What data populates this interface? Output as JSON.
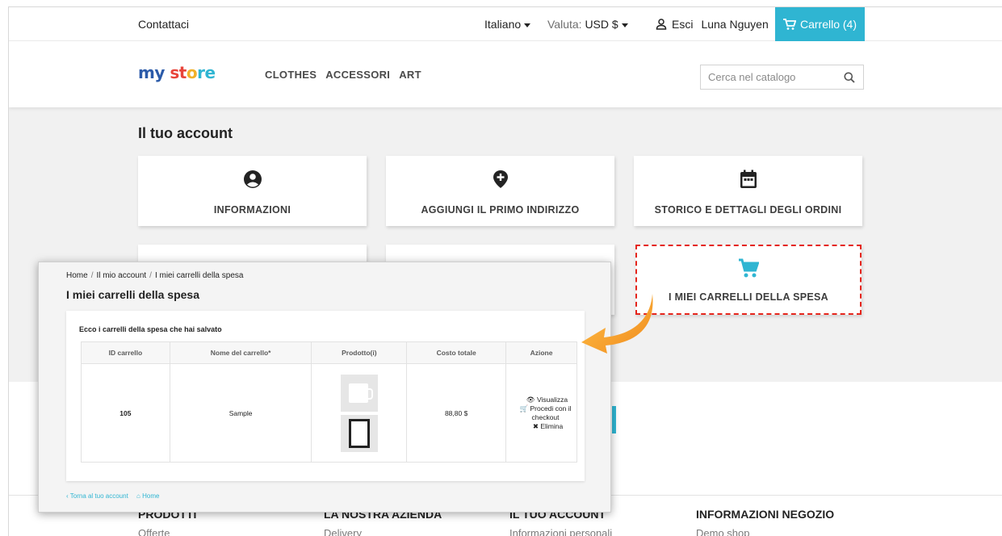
{
  "topbar": {
    "contact": "Contattaci",
    "language": "Italiano",
    "currency_label": "Valuta:",
    "currency_value": "USD $",
    "logout": "Esci",
    "user_name": "Luna Nguyen",
    "cart_label": "Carrello (4)"
  },
  "header": {
    "logo": {
      "part1": "my",
      "part2": "st",
      "part3": "o",
      "part4": "re"
    },
    "nav": [
      "CLOTHES",
      "ACCESSORI",
      "ART"
    ],
    "search_placeholder": "Cerca nel catalogo"
  },
  "account": {
    "title": "Il tuo account",
    "tiles": [
      {
        "label": "INFORMAZIONI",
        "icon": "user-circle-icon"
      },
      {
        "label": "AGGIUNGI IL PRIMO INDIRIZZO",
        "icon": "add-location-icon"
      },
      {
        "label": "STORICO E DETTAGLI DEGLI ORDINI",
        "icon": "calendar-icon"
      },
      {
        "label": "I MIEI CARRELLI DELLA SPESA",
        "icon": "shopping-cart-icon"
      }
    ]
  },
  "overlay": {
    "breadcrumb": [
      "Home",
      "Il mio account",
      "I miei carrelli della spesa"
    ],
    "title": "I miei carrelli della spesa",
    "card_title": "Ecco i carrelli della spesa che hai salvato",
    "columns": [
      "ID carrello",
      "Nome del carrello*",
      "Prodotto(i)",
      "Costo totale",
      "Azione"
    ],
    "row": {
      "id": "105",
      "name": "Sample",
      "total": "88,80 $",
      "actions": [
        "Visualizza",
        "Procedi con il",
        "checkout",
        "Elimina"
      ]
    },
    "back_link": "Torna al tuo account",
    "home_link": "Home"
  },
  "footer": {
    "cols": [
      {
        "heading": "PRODOTTI",
        "item": "Offerte"
      },
      {
        "heading": "LA NOSTRA AZIENDA",
        "item": "Delivery"
      },
      {
        "heading": "IL TUO ACCOUNT",
        "item": "Informazioni personali"
      },
      {
        "heading": "INFORMAZIONI NEGOZIO",
        "item": "Demo shop"
      }
    ]
  },
  "colors": {
    "accent": "#2fb5d2",
    "highlight_border": "#e5251c",
    "arrow": "#f5a623"
  }
}
